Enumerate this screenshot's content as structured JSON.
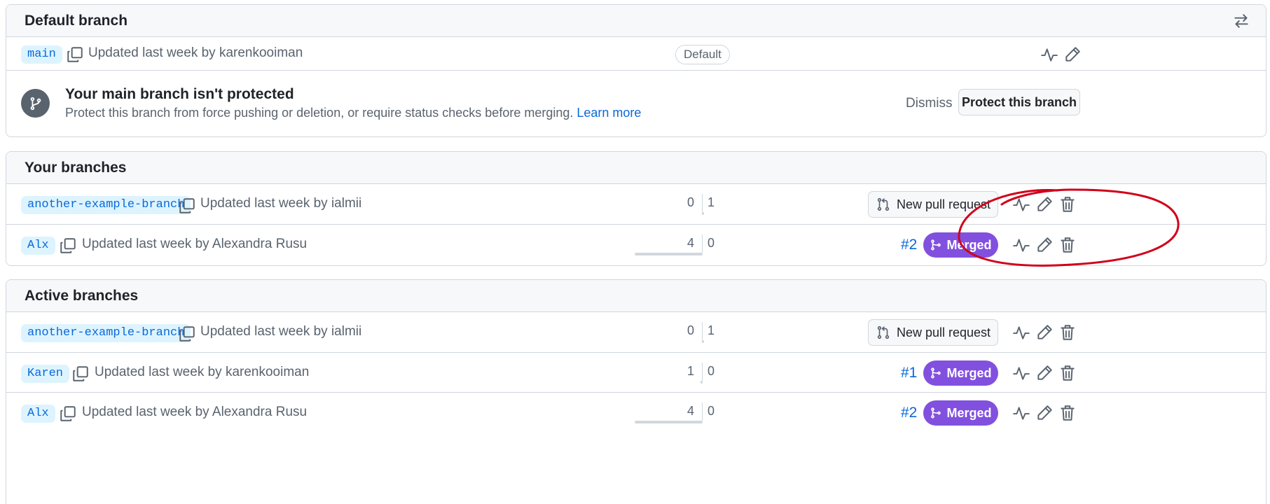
{
  "default_section": {
    "title": "Default branch",
    "branch": {
      "name": "main",
      "updated": "Updated last week by karenkooiman",
      "badge": "Default"
    },
    "protection": {
      "title": "Your main branch isn't protected",
      "description": "Protect this branch from force pushing or deletion, or require status checks before merging.",
      "learn_more": "Learn more",
      "dismiss": "Dismiss",
      "protect_button": "Protect this branch"
    }
  },
  "your_branches": {
    "title": "Your branches",
    "rows": [
      {
        "name": "another-example-branch",
        "updated": "Updated last week by ialmii",
        "ahead": "0",
        "behind": "1",
        "action": "New pull request"
      },
      {
        "name": "Alx",
        "updated": "Updated last week by Alexandra Rusu",
        "ahead": "4",
        "behind": "0",
        "pr": "#2",
        "status": "Merged"
      }
    ]
  },
  "active_branches": {
    "title": "Active branches",
    "rows": [
      {
        "name": "another-example-branch",
        "updated": "Updated last week by ialmii",
        "ahead": "0",
        "behind": "1",
        "action": "New pull request"
      },
      {
        "name": "Karen",
        "updated": "Updated last week by karenkooiman",
        "ahead": "1",
        "behind": "0",
        "pr": "#1",
        "status": "Merged"
      },
      {
        "name": "Alx",
        "updated": "Updated last week by Alexandra Rusu",
        "ahead": "4",
        "behind": "0",
        "pr": "#2",
        "status": "Merged"
      }
    ]
  },
  "colors": {
    "accent": "#0969da",
    "merged": "#8250df",
    "annotation": "#d0021b"
  },
  "icons": [
    "switch-arrows-icon",
    "copy-icon",
    "activity-icon",
    "pencil-icon",
    "trash-icon",
    "git-branch-icon",
    "pull-request-icon",
    "merge-icon"
  ]
}
